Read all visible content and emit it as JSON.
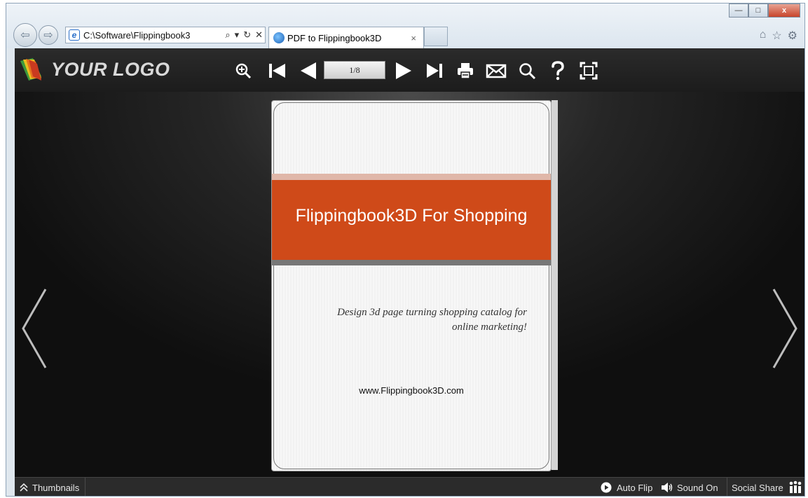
{
  "browser": {
    "address": "C:\\Software\\Flippingbook3",
    "tab_title": "PDF to Flippingbook3D",
    "tab_close": "×",
    "search_glyph": "⌕",
    "dropdown_glyph": "▾",
    "refresh_glyph": "↻",
    "stop_glyph": "✕",
    "win_minimize": "—",
    "win_maximize": "□",
    "win_close": "x",
    "tools": [
      "⌂",
      "☆",
      "⚙"
    ]
  },
  "toolbar": {
    "logo_text": "YOUR LOGO",
    "page_indicator": "1/8"
  },
  "book": {
    "title": "Flippingbook3D For Shopping",
    "subtitle_line1": "Design 3d page turning shopping catalog for",
    "subtitle_line2": "online marketing!",
    "website": "www.Flippingbook3D.com"
  },
  "bottombar": {
    "thumbnails": "Thumbnails",
    "auto_flip": "Auto Flip",
    "sound": "Sound On",
    "social_share": "Social Share"
  },
  "colors": {
    "banner": "#cf4a19",
    "toolbar_bg": "#1f1f1f",
    "stage_bg": "#111111"
  }
}
